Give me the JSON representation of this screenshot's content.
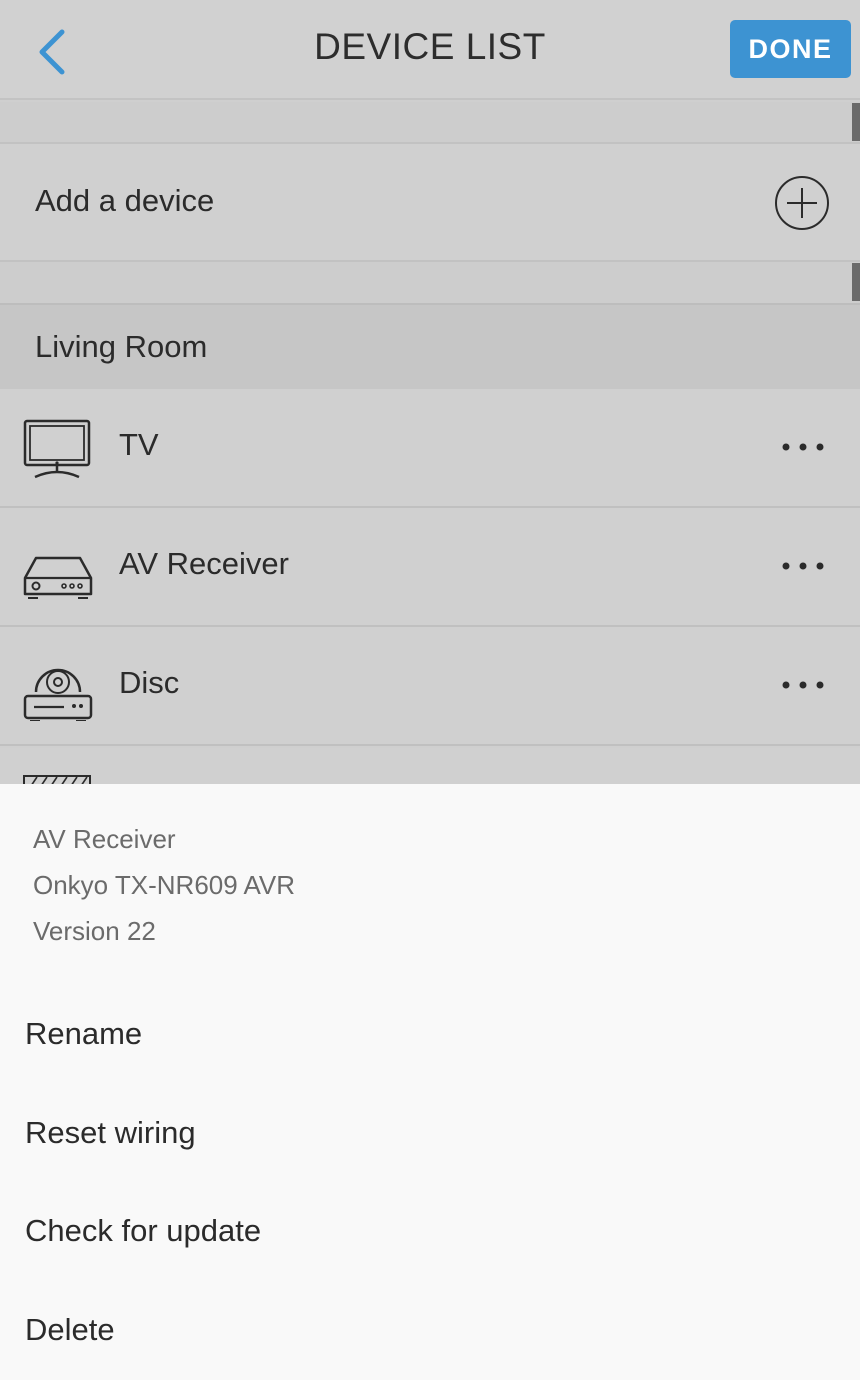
{
  "header": {
    "title": "DEVICE LIST",
    "done_label": "DONE",
    "accent_color": "#3d93d2"
  },
  "add_device": {
    "label": "Add a device",
    "icon": "plus-circle-icon"
  },
  "section": {
    "label": "Living Room"
  },
  "devices": [
    {
      "label": "TV",
      "icon": "tv-icon"
    },
    {
      "label": "AV Receiver",
      "icon": "av-receiver-icon"
    },
    {
      "label": "Disc",
      "icon": "disc-player-icon"
    }
  ],
  "sheet": {
    "info": {
      "type": "AV Receiver",
      "model": "Onkyo TX-NR609 AVR",
      "version": "Version 22"
    },
    "actions": [
      {
        "label": "Rename"
      },
      {
        "label": "Reset wiring"
      },
      {
        "label": "Check for update"
      },
      {
        "label": "Delete"
      }
    ]
  }
}
